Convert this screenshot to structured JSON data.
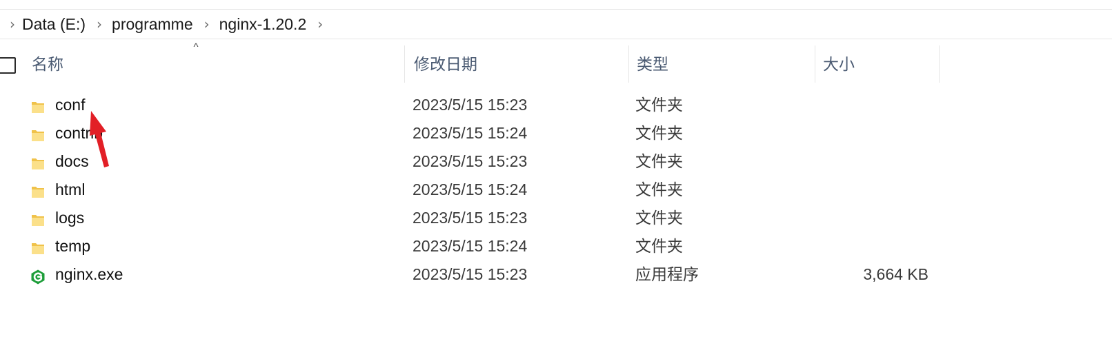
{
  "breadcrumb": {
    "items": [
      {
        "label": "Data (E:)"
      },
      {
        "label": "programme"
      },
      {
        "label": "nginx-1.20.2"
      }
    ]
  },
  "columns": {
    "name": "名称",
    "date_modified": "修改日期",
    "type": "类型",
    "size": "大小",
    "sort_indicator": "^"
  },
  "files": [
    {
      "name": "conf",
      "date": "2023/5/15 15:23",
      "type": "文件夹",
      "size": "",
      "icon": "folder-icon"
    },
    {
      "name": "contrib",
      "date": "2023/5/15 15:24",
      "type": "文件夹",
      "size": "",
      "icon": "folder-icon"
    },
    {
      "name": "docs",
      "date": "2023/5/15 15:23",
      "type": "文件夹",
      "size": "",
      "icon": "folder-icon"
    },
    {
      "name": "html",
      "date": "2023/5/15 15:24",
      "type": "文件夹",
      "size": "",
      "icon": "folder-icon"
    },
    {
      "name": "logs",
      "date": "2023/5/15 15:23",
      "type": "文件夹",
      "size": "",
      "icon": "folder-icon"
    },
    {
      "name": "temp",
      "date": "2023/5/15 15:24",
      "type": "文件夹",
      "size": "",
      "icon": "folder-icon"
    },
    {
      "name": "nginx.exe",
      "date": "2023/5/15 15:23",
      "type": "应用程序",
      "size": "3,664 KB",
      "icon": "nginx-app-icon"
    }
  ],
  "colors": {
    "folder": "#f0c24a",
    "folder_light": "#fbe08a",
    "nginx_green": "#1e9e3a",
    "annotation_red": "#e21f26",
    "header_text": "#4a5a72"
  }
}
